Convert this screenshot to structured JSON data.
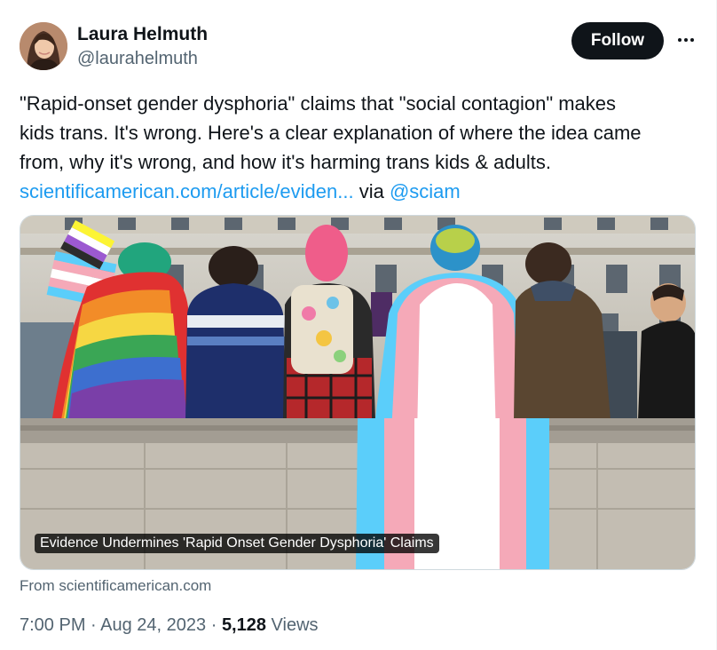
{
  "author": {
    "name": "Laura Helmuth",
    "handle": "@laurahelmuth",
    "avatar_icon": "profile-photo"
  },
  "actions": {
    "follow_label": "Follow",
    "more_icon": "more-horizontal-icon"
  },
  "tweet": {
    "line1": "\"Rapid-onset gender dysphoria\" claims that \"social contagion\" makes",
    "line2": "kids trans. It's wrong. Here's a clear explanation of where the idea came",
    "line3": "from, why it's wrong, and how it's harming trans kids & adults.",
    "link_text": "scientificamerican.com/article/eviden...",
    "via_text": " via ",
    "mention": "@sciam"
  },
  "card": {
    "caption": "Evidence Undermines 'Rapid Onset Gender Dysphoria' Claims",
    "source": "From scientificamerican.com"
  },
  "meta": {
    "time": "7:00 PM",
    "sep1": " · ",
    "date": "Aug 24, 2023",
    "sep2": " · ",
    "views_count": "5,128",
    "views_label": " Views"
  },
  "colors": {
    "link": "#1d9bf0",
    "text": "#0f1419",
    "secondary": "#536471",
    "follow_bg": "#0f1419"
  }
}
